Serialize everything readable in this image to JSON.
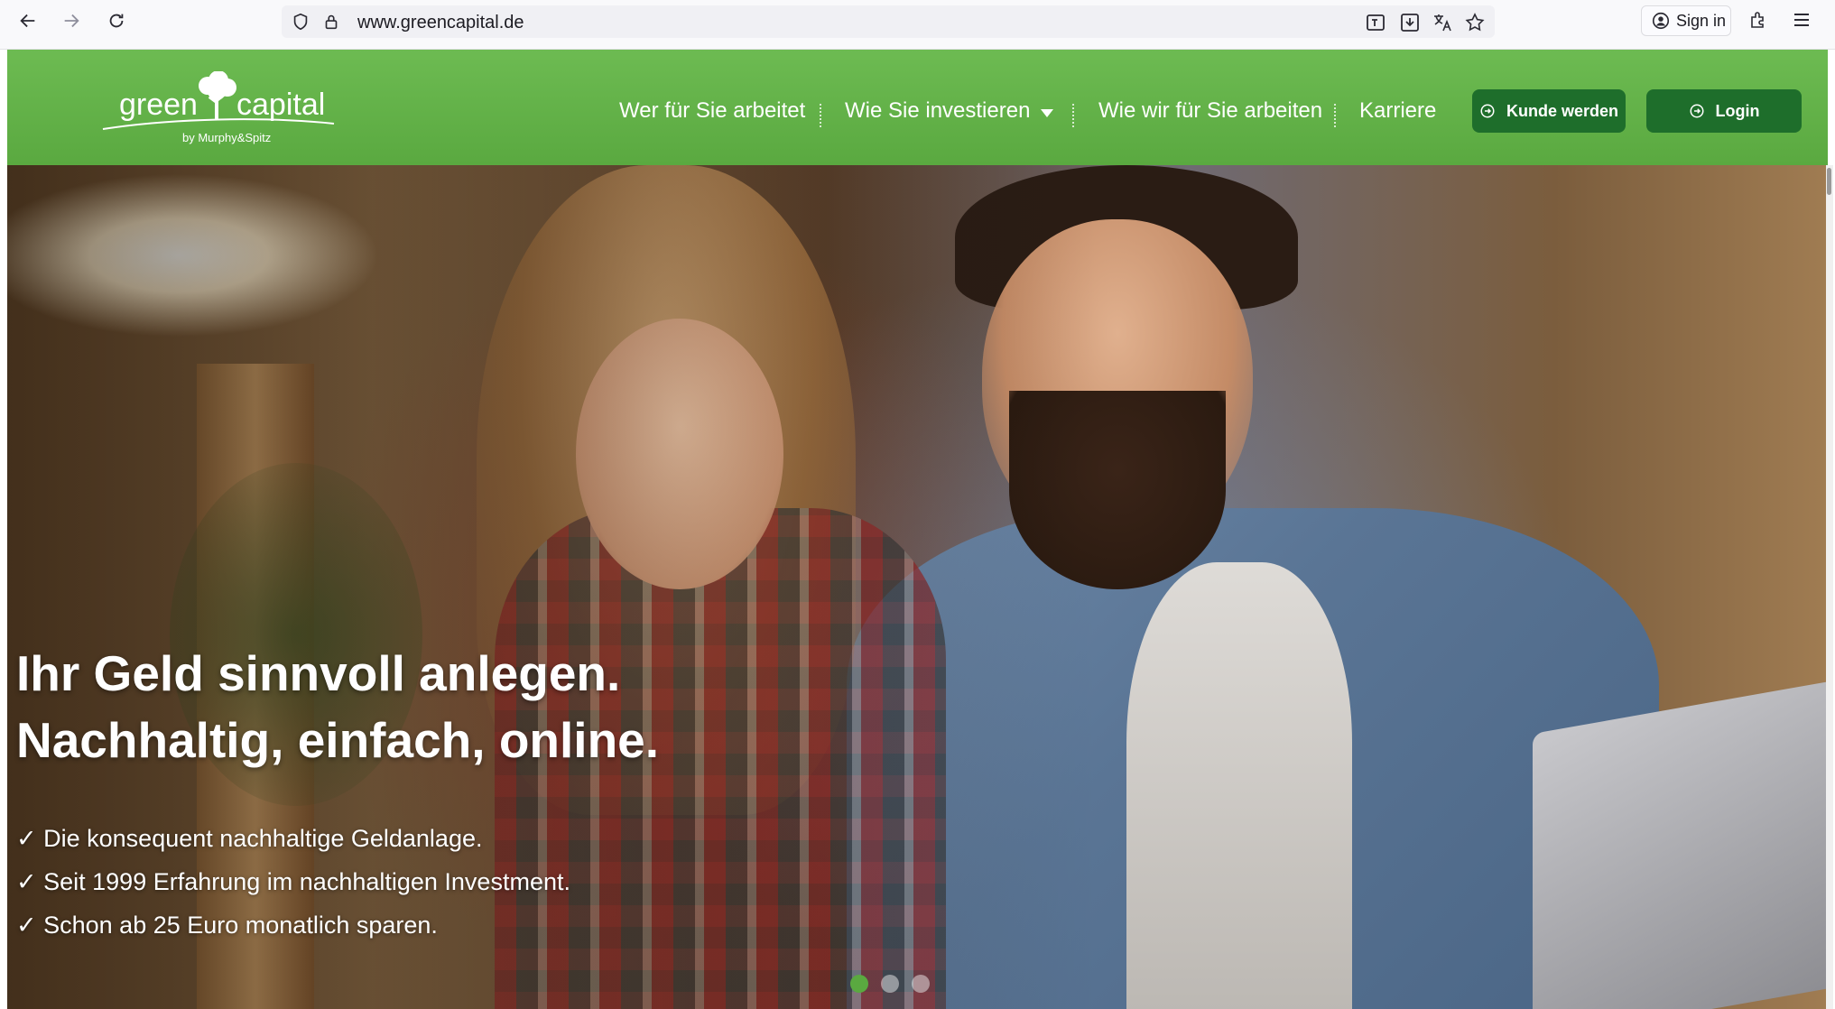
{
  "browser": {
    "url": "www.greencapital.de",
    "sign_in_label": "Sign in"
  },
  "site": {
    "logo": {
      "word_left": "green",
      "word_right": "capital",
      "subline": "by Murphy&Spitz"
    },
    "nav": [
      {
        "label": "Wer für Sie arbeitet"
      },
      {
        "label": "Wie Sie investieren",
        "has_dropdown": true
      },
      {
        "label": "Wie wir für Sie arbeiten"
      },
      {
        "label": "Karriere"
      }
    ],
    "buttons": {
      "register": "Kunde werden",
      "login": "Login"
    },
    "colors": {
      "header_green": "#5aa940",
      "button_dark_green": "#1e6e2b"
    }
  },
  "hero": {
    "headline_line1": "Ihr Geld sinnvoll anlegen.",
    "headline_line2": "Nachhaltig, einfach, online.",
    "bullets": [
      "✓ Die konsequent nachhaltige Geldanlage.",
      "✓ Seit 1999 Erfahrung im nachhaltigen Investment.",
      "✓ Schon ab 25 Euro monatlich sparen."
    ],
    "slider": {
      "total": 3,
      "active": 1
    }
  }
}
